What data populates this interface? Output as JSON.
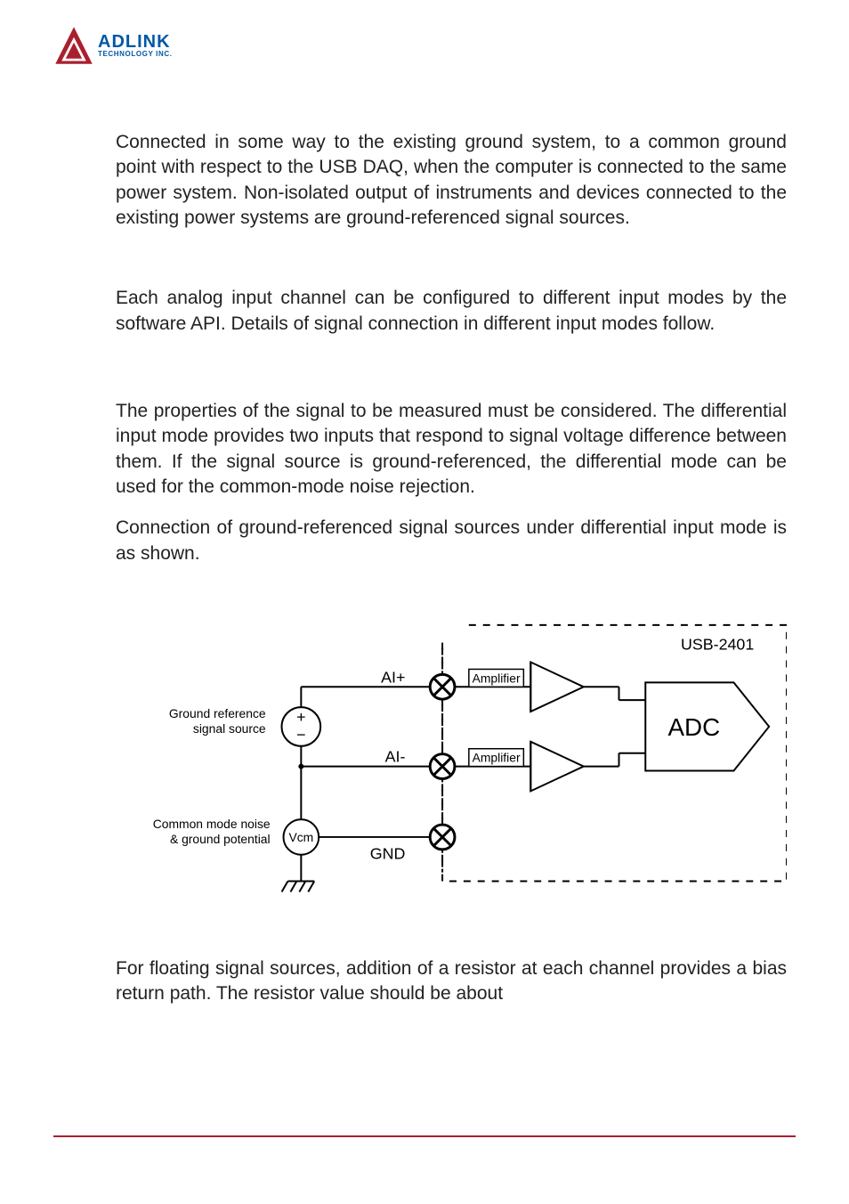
{
  "logo": {
    "brand_line1": "ADLINK",
    "brand_line2": "TECHNOLOGY INC."
  },
  "paragraphs": {
    "p1": "Connected in some way to the existing ground system, to a common ground point with respect to the USB DAQ, when the computer is connected to the same power system. Non-isolated output of instruments and devices connected to the existing power systems are ground-referenced signal sources.",
    "p2": "Each analog input channel can be configured to different input modes by the software API. Details of signal connection in different input modes follow.",
    "p3": "The properties of the signal to be measured must be considered. The differential input mode provides two inputs that respond to signal voltage difference between them. If the signal source is ground-referenced, the differential mode can be used for the common-mode noise rejection.",
    "p4": "Connection of ground-referenced signal sources under differential input mode is as shown.",
    "p5": "For floating signal sources, addition of a resistor at each channel provides a bias return path. The resistor value should be about"
  },
  "diagram": {
    "device_label": "USB-2401",
    "ai_plus": "AI+",
    "ai_minus": "AI-",
    "gnd": "GND",
    "amplifier": "Amplifier",
    "adc": "ADC",
    "signal_source_line1": "Ground reference",
    "signal_source_line2": "signal source",
    "vcm": "Vcm",
    "noise_line1": "Common mode noise",
    "noise_line2": "& ground potential",
    "plus": "+",
    "minus": "−"
  },
  "colors": {
    "brand_blue": "#0058a5",
    "brand_red": "#aa1f2e"
  }
}
